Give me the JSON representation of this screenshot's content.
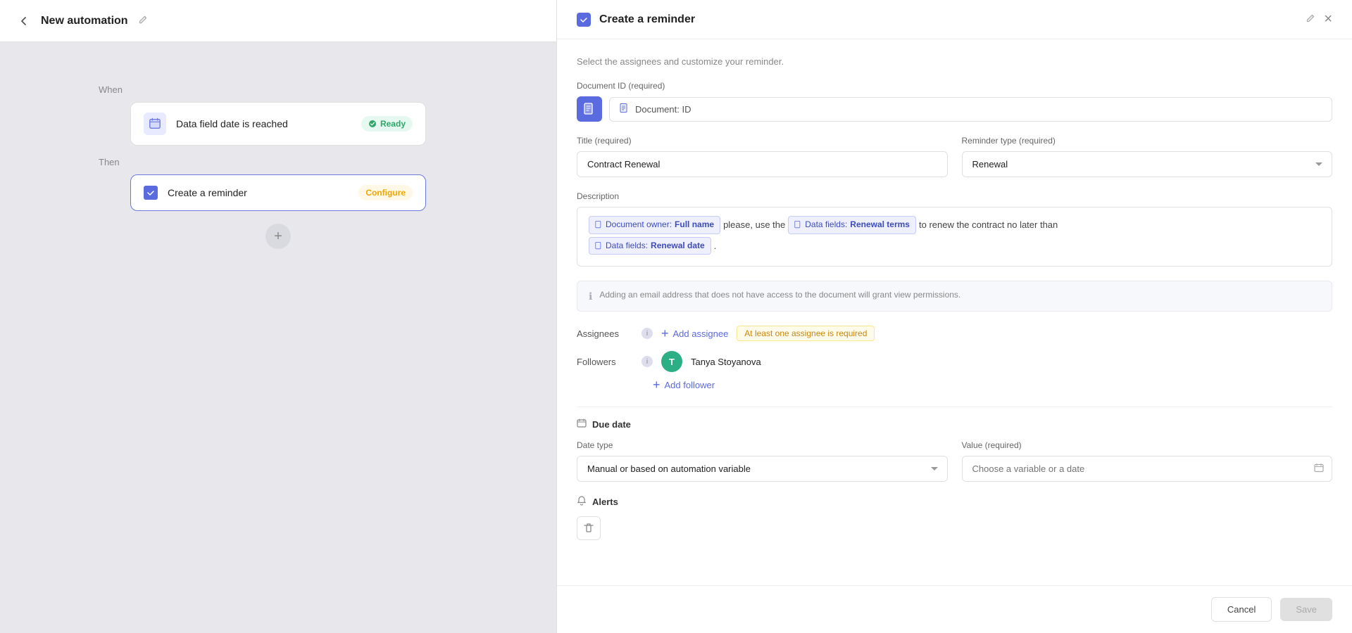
{
  "topbar": {
    "title": "New automation",
    "back_aria": "Go back",
    "edit_aria": "Edit title"
  },
  "flow": {
    "when_label": "When",
    "then_label": "Then",
    "when_card": {
      "text": "Data field date is reached",
      "badge": "Ready"
    },
    "then_card": {
      "text": "Create a reminder",
      "badge": "Configure"
    }
  },
  "panel": {
    "title": "Create a reminder",
    "subtitle": "Select the assignees and customize your reminder.",
    "doc_id_label": "Document ID (required)",
    "doc_id_value": "Document: ID",
    "title_label": "Title (required)",
    "title_value": "Contract Renewal",
    "reminder_type_label": "Reminder type (required)",
    "reminder_type_value": "Renewal",
    "description_label": "Description",
    "description": {
      "part1": "Document owner:",
      "part1_bold": "Full name",
      "part2": "please, use the",
      "part3": "Data fields:",
      "part3_bold": "Renewal terms",
      "part4": "to renew the contract no later than",
      "part5": "Data fields:",
      "part5_bold": "Renewal date",
      "part6": "."
    },
    "info_text": "Adding an email address that does not have access to the document will grant view permissions.",
    "assignees_label": "Assignees",
    "add_assignee_label": "Add assignee",
    "assignee_warning": "At least one assignee is required",
    "followers_label": "Followers",
    "follower_name": "Tanya Stoyanova",
    "follower_initial": "T",
    "add_follower_label": "Add follower",
    "due_date_label": "Due date",
    "date_type_label": "Date type",
    "date_type_value": "Manual or based on automation variable",
    "value_label": "Value (required)",
    "value_placeholder": "Choose a variable or a date",
    "alerts_label": "Alerts",
    "cancel_label": "Cancel",
    "save_label": "Save"
  }
}
